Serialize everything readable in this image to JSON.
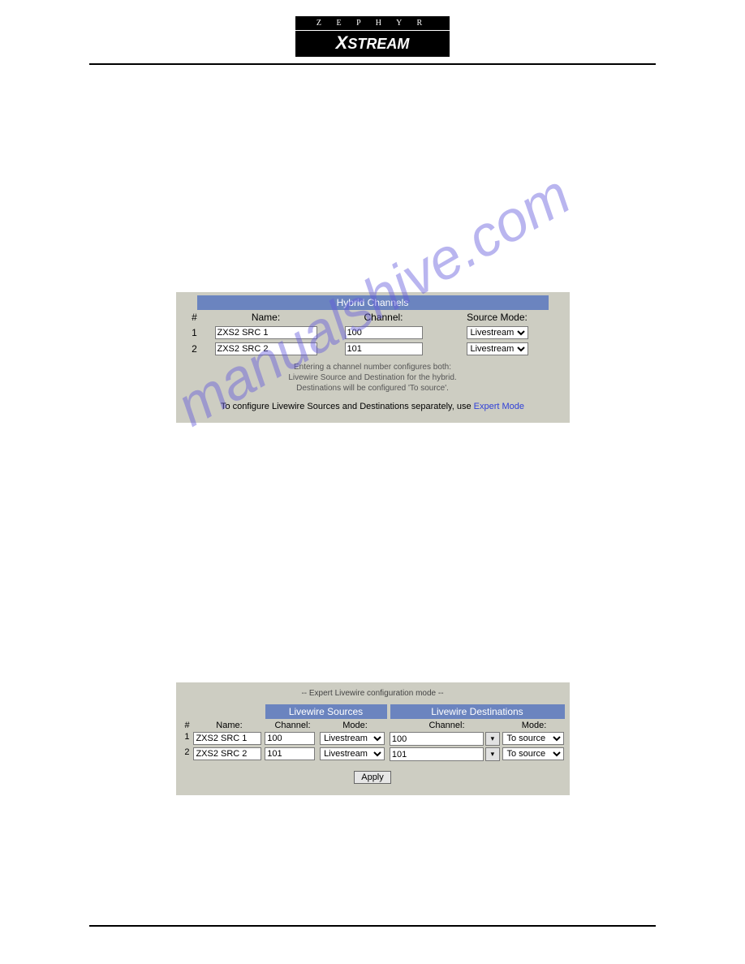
{
  "watermark": "manualshive.com",
  "logo": {
    "top": "Z E P H Y R",
    "bottom_prefix": "X",
    "bottom_rest": "STREAM"
  },
  "panel1": {
    "title": "Hybrid Channels",
    "headers": {
      "num": "#",
      "name": "Name:",
      "channel": "Channel:",
      "mode": "Source Mode:"
    },
    "rows": [
      {
        "num": "1",
        "name": "ZXS2 SRC 1",
        "channel": "100",
        "mode": "Livestream"
      },
      {
        "num": "2",
        "name": "ZXS2 SRC 2",
        "channel": "101",
        "mode": "Livestream"
      }
    ],
    "help1": "Entering a channel number configures both:",
    "help2": "Livewire Source and Destination for the hybrid.",
    "help3": "Destinations will be configured 'To source'.",
    "config_prefix": "To configure Livewire Sources and Destinations separately, use ",
    "config_link": "Expert Mode"
  },
  "panel2": {
    "title": "-- Expert Livewire configuration mode --",
    "src_header": "Livewire Sources",
    "dst_header": "Livewire Destinations",
    "headers": {
      "num": "#",
      "name": "Name:",
      "channel": "Channel:",
      "mode": "Mode:",
      "dst_channel": "Channel:",
      "dst_mode": "Mode:"
    },
    "rows": [
      {
        "num": "1",
        "name": "ZXS2 SRC 1",
        "src_channel": "100",
        "src_mode": "Livestream",
        "dst_channel": "100",
        "dst_mode": "To source"
      },
      {
        "num": "2",
        "name": "ZXS2 SRC 2",
        "src_channel": "101",
        "src_mode": "Livestream",
        "dst_channel": "101",
        "dst_mode": "To source"
      }
    ],
    "apply": "Apply"
  }
}
